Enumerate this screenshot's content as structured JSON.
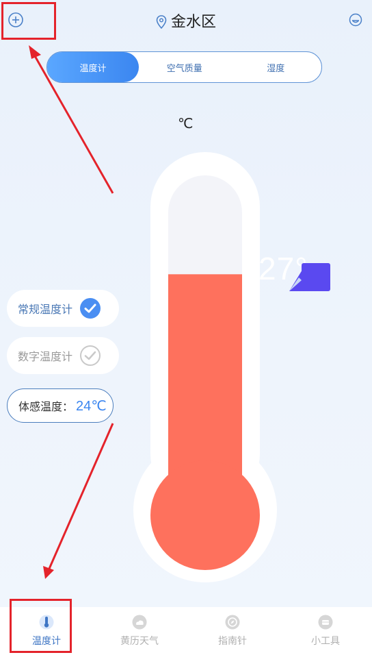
{
  "header": {
    "location": "金水区",
    "add_icon": "plus-circle-icon",
    "smile_icon": "smile-icon"
  },
  "tabs": [
    {
      "label": "温度计",
      "active": true
    },
    {
      "label": "空气质量",
      "active": false
    },
    {
      "label": "湿度",
      "active": false
    }
  ],
  "unit_label": "℃",
  "thermometer": {
    "reading": "27°",
    "fill_fraction": 0.7,
    "fill_color": "#fe715d",
    "empty_color": "#f3f4f9"
  },
  "modes": {
    "normal_label": "常规温度计",
    "digital_label": "数字温度计",
    "feel_label": "体感温度：",
    "feel_value": "24℃"
  },
  "bottom_nav": [
    {
      "label": "温度计",
      "icon": "thermometer-icon",
      "active": true
    },
    {
      "label": "黄历天气",
      "icon": "cloud-icon",
      "active": false
    },
    {
      "label": "指南针",
      "icon": "compass-icon",
      "active": false
    },
    {
      "label": "小工具",
      "icon": "toolbox-icon",
      "active": false
    }
  ],
  "colors": {
    "accent": "#3b86f0",
    "highlight_red": "#e4232b",
    "flag": "#5a49f0"
  }
}
